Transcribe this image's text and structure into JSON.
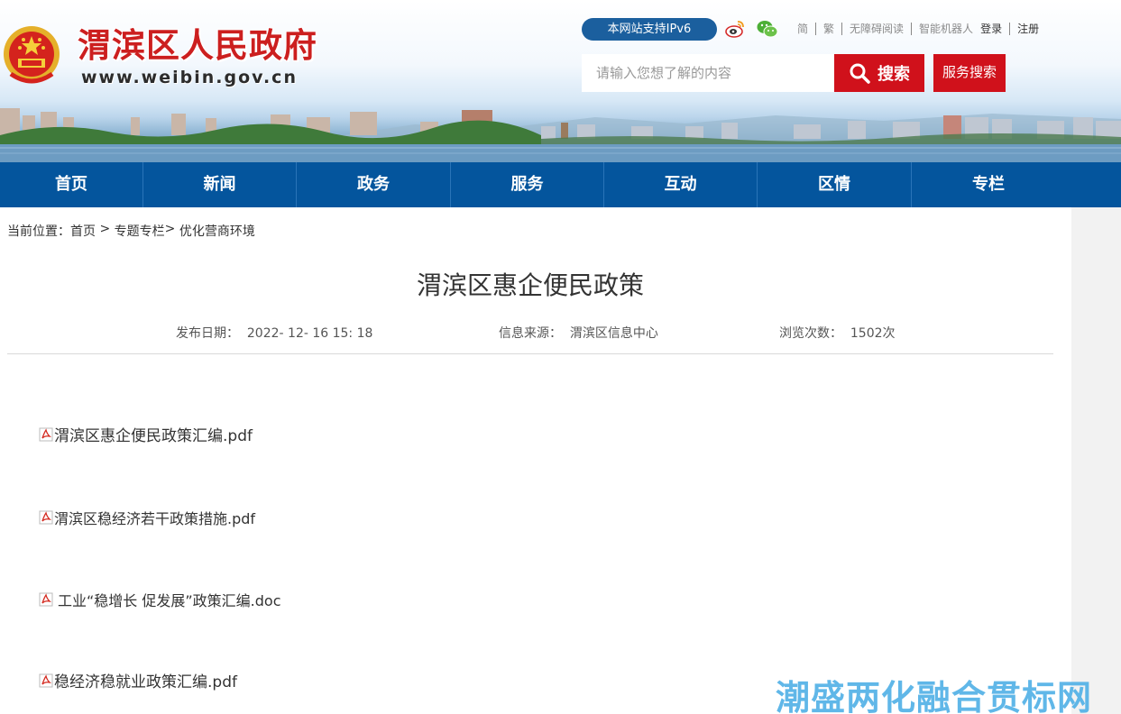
{
  "header": {
    "site_title": "渭滨区人民政府",
    "site_url": "www.weibin.gov.cn",
    "ipv6_badge": "本网站支持IPv6",
    "top_links": [
      "简",
      "繁",
      "无障碍阅读",
      "智能机器人"
    ],
    "login": "登录",
    "register": "注册",
    "search_placeholder": "请输入您想了解的内容",
    "search_button": "搜索",
    "service_search_button": "服务搜索"
  },
  "nav": {
    "items": [
      "首页",
      "新闻",
      "政务",
      "服务",
      "互动",
      "区情",
      "专栏"
    ]
  },
  "breadcrumb": {
    "label": "当前位置：",
    "home": "首页",
    "sep1": " > ",
    "section": "专题专栏",
    "sep2": "> ",
    "current": "优化营商环境"
  },
  "article": {
    "title": "渭滨区惠企便民政策",
    "publish_date": "发布日期：  2022- 12- 16 15: 18",
    "source": "信息来源：  渭滨区信息中心",
    "views": "浏览次数：  1502次",
    "files": [
      "渭滨区惠企便民政策汇编.pdf",
      "渭滨区稳经济若干政策措施.pdf",
      "工业“稳增长 促发展”政策汇编.doc",
      "稳经济稳就业政策汇编.pdf"
    ]
  },
  "watermark": "潮盛两化融合贯标网",
  "colors": {
    "nav_bg": "#04559d",
    "accent_red": "#d0111b",
    "ipv6_bg": "#1b5f9e",
    "title_red": "#cc1f1f"
  },
  "icons": [
    "weibo-icon",
    "wechat-icon",
    "search-icon",
    "pdf-icon",
    "national-emblem-icon"
  ]
}
